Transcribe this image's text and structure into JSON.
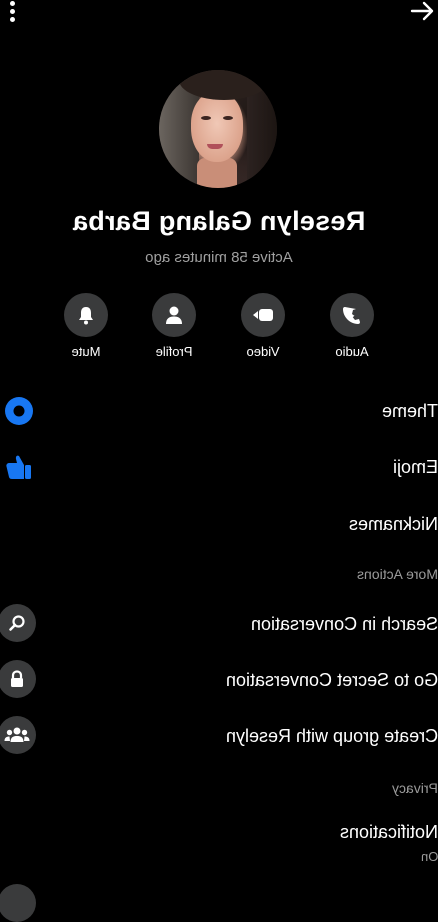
{
  "header": {
    "menu_icon": "vertical-dots-icon",
    "back_icon": "arrow-right-icon"
  },
  "profile": {
    "name": "Reselyn Galang Barba",
    "status": "Active 58 minutes ago"
  },
  "actions": [
    {
      "label": "Audio",
      "icon": "phone-icon"
    },
    {
      "label": "Video",
      "icon": "video-camera-icon"
    },
    {
      "label": "Profile",
      "icon": "person-icon"
    },
    {
      "label": "Mute",
      "icon": "bell-icon"
    }
  ],
  "customize": {
    "theme": "Theme",
    "emoji": "Emoji",
    "nicknames": "Nicknames"
  },
  "more_actions": {
    "header": "More Actions",
    "search": "Search in Conversation",
    "secret": "Go to Secret Conversation",
    "group": "Create group with Reselyn"
  },
  "privacy": {
    "header": "Privacy",
    "notifications": "Notifications",
    "notifications_value": "On"
  },
  "colors": {
    "accent": "#1877f2",
    "icon_bg": "#3a3b3c",
    "secondary_text": "#9b9b9b"
  }
}
